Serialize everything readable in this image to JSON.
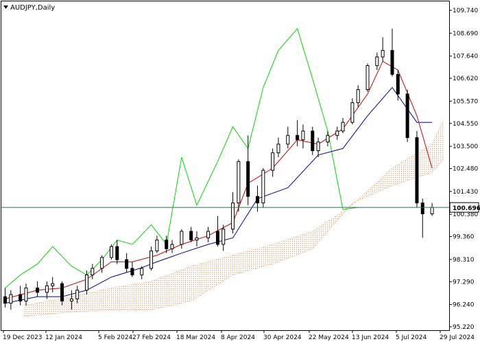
{
  "window": {
    "symbol_label": "AUDJPY,Daily"
  },
  "colors": {
    "background": "#ffffff",
    "frame": "#000000",
    "candles": "#000000",
    "tenkan_sen": "#cc0000",
    "kijun_sen": "#000099",
    "chikou_span": "#00dd00",
    "kumo_cloud": "#e0a070",
    "price_line": "#2f6f4f",
    "price_label_bg": "#ffffff"
  },
  "chart_data": {
    "type": "candlestick",
    "title": "AUDJPY,Daily",
    "y_axis": {
      "ticks": [
        "109.740",
        "108.690",
        "107.640",
        "106.620",
        "105.570",
        "104.550",
        "103.500",
        "102.480",
        "101.430",
        "100.380",
        "99.360",
        "98.310",
        "97.290",
        "96.240",
        "95.220"
      ],
      "range": [
        95.22,
        109.74
      ]
    },
    "x_axis": {
      "ticks": [
        "19 Dec 2023",
        "12 Jan 2024",
        "5 Feb 2024",
        "27 Feb 2024",
        "18 Mar 2024",
        "8 Apr 2024",
        "30 Apr 2024",
        "22 May 2024",
        "13 Jun 2024",
        "5 Jul 2024",
        "29 Jul 2024"
      ]
    },
    "current_price": "100.696",
    "indicators": [
      "Tenkan-sen",
      "Kijun-sen",
      "Chikou Span",
      "Kumo cloud"
    ],
    "series": [
      {
        "name": "OHLC",
        "x": [
          "2023-12-18",
          "2023-12-21",
          "2023-12-26",
          "2023-12-29",
          "2024-01-04",
          "2024-01-09",
          "2024-01-12",
          "2024-01-17",
          "2024-01-22",
          "2024-01-25",
          "2024-01-30",
          "2024-02-02",
          "2024-02-07",
          "2024-02-12",
          "2024-02-15",
          "2024-02-20",
          "2024-02-23",
          "2024-02-28",
          "2024-03-04",
          "2024-03-07",
          "2024-03-12",
          "2024-03-15",
          "2024-03-20",
          "2024-03-25",
          "2024-03-28",
          "2024-04-03",
          "2024-04-08",
          "2024-04-11",
          "2024-04-16",
          "2024-04-19",
          "2024-04-24",
          "2024-04-29",
          "2024-05-02",
          "2024-05-07",
          "2024-05-10",
          "2024-05-15",
          "2024-05-20",
          "2024-05-23",
          "2024-05-28",
          "2024-05-31",
          "2024-06-05",
          "2024-06-10",
          "2024-06-13",
          "2024-06-18",
          "2024-06-21",
          "2024-06-26",
          "2024-07-01",
          "2024-07-04",
          "2024-07-09",
          "2024-07-12",
          "2024-07-17",
          "2024-07-22",
          "2024-07-25",
          "2024-07-30"
        ],
        "open": [
          96.6,
          96.3,
          96.7,
          96.4,
          97.0,
          96.8,
          97.1,
          97.2,
          96.4,
          96.5,
          96.9,
          97.6,
          97.9,
          98.4,
          98.9,
          98.3,
          97.9,
          97.6,
          97.9,
          98.7,
          99.2,
          98.8,
          99.0,
          99.6,
          99.2,
          99.3,
          99.6,
          99.0,
          99.7,
          100.9,
          102.8,
          101.2,
          100.9,
          102.4,
          103.2,
          103.6,
          104.0,
          103.8,
          104.2,
          103.3,
          103.7,
          104.0,
          104.2,
          104.6,
          105.5,
          106.1,
          107.2,
          107.6,
          107.9,
          106.8,
          105.9,
          103.9,
          100.9,
          100.4
        ],
        "high": [
          97.0,
          96.9,
          97.1,
          97.2,
          97.3,
          97.3,
          97.5,
          97.3,
          96.9,
          97.1,
          97.8,
          98.1,
          98.5,
          99.0,
          99.2,
          98.6,
          98.2,
          98.0,
          98.9,
          99.4,
          99.4,
          99.2,
          99.7,
          99.8,
          99.6,
          99.8,
          100.3,
          99.9,
          101.4,
          102.9,
          104.0,
          101.7,
          102.5,
          103.4,
          103.9,
          104.4,
          104.7,
          104.5,
          104.4,
          103.9,
          104.2,
          104.4,
          104.8,
          105.7,
          106.3,
          107.3,
          107.8,
          108.5,
          108.9,
          107.0,
          106.1,
          104.2,
          101.1,
          100.9
        ],
        "low": [
          96.1,
          96.0,
          96.2,
          96.2,
          96.6,
          96.5,
          96.8,
          96.2,
          96.0,
          96.3,
          96.7,
          97.4,
          97.7,
          98.3,
          98.1,
          97.7,
          97.5,
          97.4,
          97.8,
          98.6,
          98.6,
          98.6,
          98.8,
          99.1,
          98.9,
          99.1,
          98.9,
          98.7,
          99.5,
          100.5,
          100.8,
          100.5,
          100.7,
          102.1,
          103.0,
          103.4,
          103.5,
          103.4,
          103.1,
          103.0,
          103.5,
          103.8,
          104.1,
          104.5,
          105.3,
          106.0,
          107.0,
          107.4,
          106.7,
          105.6,
          103.7,
          100.7,
          99.3,
          100.3
        ],
        "close": [
          96.3,
          96.7,
          96.4,
          97.0,
          96.8,
          97.1,
          97.2,
          96.4,
          96.5,
          96.9,
          97.6,
          97.9,
          98.4,
          98.9,
          98.3,
          97.9,
          97.6,
          97.9,
          98.7,
          99.2,
          98.8,
          99.0,
          99.6,
          99.2,
          99.3,
          99.6,
          99.0,
          99.7,
          100.9,
          102.8,
          101.2,
          100.9,
          102.4,
          103.2,
          103.6,
          104.0,
          103.8,
          104.2,
          103.3,
          103.7,
          104.0,
          104.2,
          104.6,
          105.5,
          106.1,
          107.2,
          107.6,
          107.9,
          106.8,
          105.9,
          103.9,
          100.9,
          100.4,
          100.7
        ]
      },
      {
        "name": "Tenkan-sen",
        "x": [
          "2023-12-18",
          "2024-01-04",
          "2024-01-17",
          "2024-01-30",
          "2024-02-12",
          "2024-02-23",
          "2024-03-07",
          "2024-03-20",
          "2024-04-03",
          "2024-04-16",
          "2024-04-24",
          "2024-05-07",
          "2024-05-20",
          "2024-05-31",
          "2024-06-13",
          "2024-06-26",
          "2024-07-04",
          "2024-07-12",
          "2024-07-22",
          "2024-07-30"
        ],
        "y": [
          96.5,
          96.9,
          97.0,
          97.4,
          98.2,
          98.2,
          98.5,
          99.0,
          99.4,
          100.0,
          101.8,
          102.5,
          103.8,
          103.6,
          104.3,
          105.9,
          107.4,
          107.0,
          104.9,
          102.5
        ]
      },
      {
        "name": "Kijun-sen",
        "x": [
          "2023-12-18",
          "2024-01-04",
          "2024-01-17",
          "2024-01-30",
          "2024-02-12",
          "2024-02-27",
          "2024-03-07",
          "2024-03-20",
          "2024-04-03",
          "2024-04-16",
          "2024-04-29",
          "2024-05-15",
          "2024-05-31",
          "2024-06-13",
          "2024-06-26",
          "2024-07-09",
          "2024-07-22",
          "2024-07-30"
        ],
        "y": [
          96.3,
          96.6,
          96.6,
          96.9,
          97.5,
          97.9,
          98.2,
          98.6,
          99.0,
          99.3,
          101.1,
          101.6,
          103.1,
          103.4,
          104.9,
          106.2,
          104.6,
          104.6
        ]
      },
      {
        "name": "Chikou Span",
        "x": [
          "2023-12-18",
          "2023-12-26",
          "2024-01-04",
          "2024-01-12",
          "2024-01-22",
          "2024-01-30",
          "2024-02-07",
          "2024-02-15",
          "2024-02-23",
          "2024-03-04",
          "2024-03-12",
          "2024-03-20",
          "2024-03-28",
          "2024-04-08",
          "2024-04-16",
          "2024-04-24",
          "2024-05-02",
          "2024-05-10",
          "2024-05-20",
          "2024-05-28",
          "2024-06-05",
          "2024-06-13",
          "2024-06-21"
        ],
        "y": [
          97.0,
          97.6,
          98.1,
          98.9,
          98.0,
          97.6,
          98.3,
          99.2,
          99.0,
          99.9,
          99.0,
          103.0,
          100.8,
          102.8,
          104.4,
          103.4,
          106.2,
          107.9,
          108.9,
          106.6,
          104.2,
          100.6,
          100.7
        ]
      },
      {
        "name": "Senkou Span A",
        "x": [
          "2023-12-28",
          "2024-01-22",
          "2024-02-12",
          "2024-03-04",
          "2024-03-25",
          "2024-04-16",
          "2024-05-07",
          "2024-05-28",
          "2024-06-18",
          "2024-07-09",
          "2024-07-30",
          "2024-08-05"
        ],
        "y": [
          96.2,
          96.6,
          97.0,
          97.3,
          98.0,
          98.5,
          99.0,
          99.6,
          100.8,
          102.5,
          103.6,
          104.7
        ]
      },
      {
        "name": "Senkou Span B",
        "x": [
          "2023-12-28",
          "2024-01-22",
          "2024-02-12",
          "2024-03-04",
          "2024-03-25",
          "2024-04-16",
          "2024-05-07",
          "2024-05-28",
          "2024-06-18",
          "2024-07-09",
          "2024-07-30",
          "2024-08-05"
        ],
        "y": [
          95.7,
          95.9,
          96.0,
          96.0,
          96.4,
          97.6,
          98.1,
          98.8,
          100.9,
          101.7,
          102.3,
          102.9
        ]
      }
    ]
  }
}
